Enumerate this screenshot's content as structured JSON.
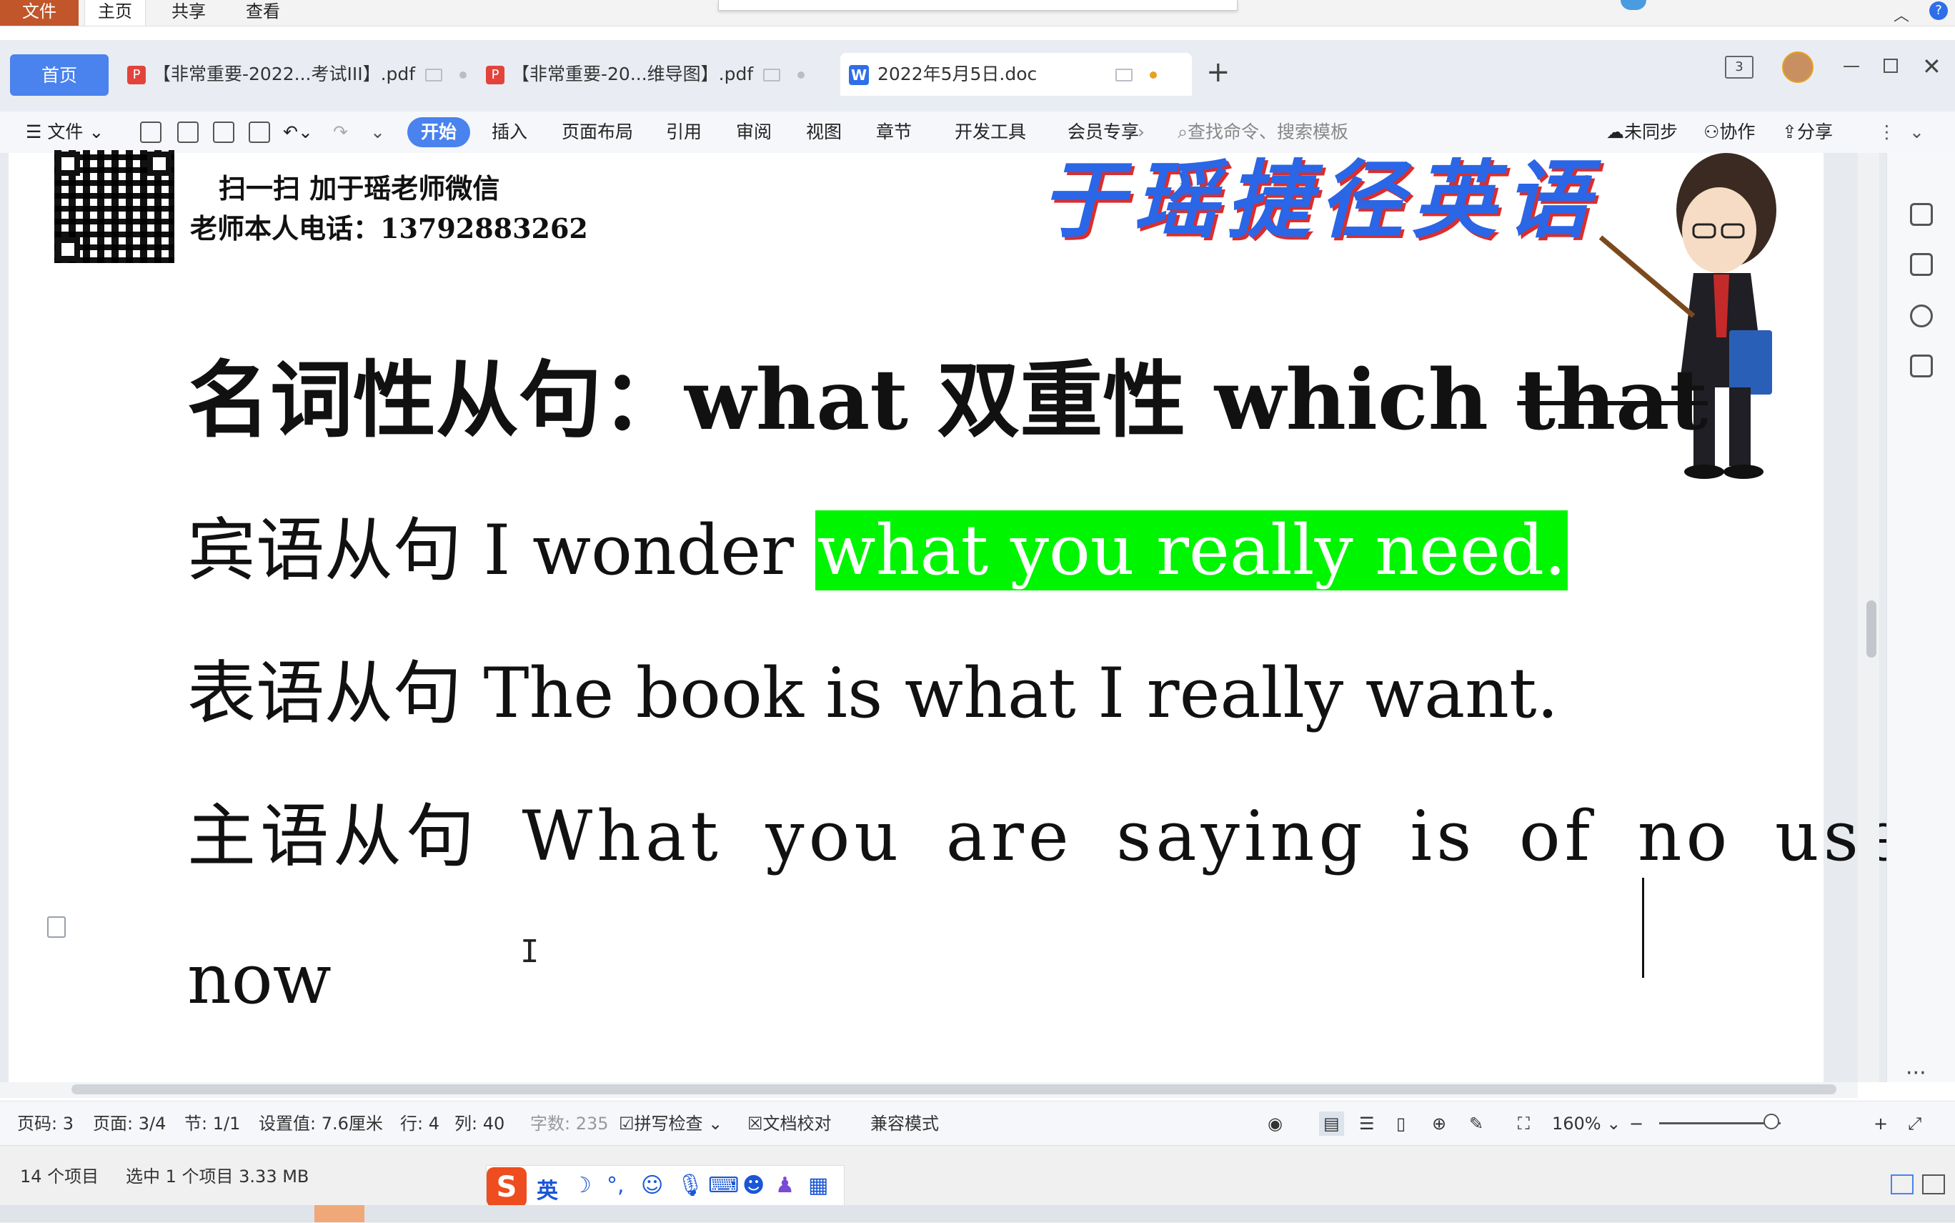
{
  "explorer": {
    "tabs": [
      "文件",
      "主页",
      "共享",
      "查看"
    ],
    "status_items": "14 个项目",
    "status_selected": "选中 1 个项目  3.33 MB"
  },
  "wps": {
    "doc_tabs": [
      {
        "label": "首页"
      },
      {
        "label": "【非常重要-2022...考试III】.pdf"
      },
      {
        "label": "【非常重要-20...维导图】.pdf"
      },
      {
        "label": "2022年5月5日.doc"
      }
    ],
    "new_tab_symbol": "+",
    "account_badge": "3",
    "toolbar": {
      "file_menu": "文件",
      "ribbon_tabs": [
        "开始",
        "插入",
        "页面布局",
        "引用",
        "审阅",
        "视图",
        "章节",
        "开发工具",
        "会员专享"
      ],
      "search_placeholder": "查找命令、搜索模板",
      "sync": "未同步",
      "collab": "协作",
      "share": "分享"
    },
    "status": {
      "page_code": "页码: 3",
      "page": "页面: 3/4",
      "section": "节: 1/1",
      "setting": "设置值: 7.6厘米",
      "row": "行: 4",
      "col": "列: 40",
      "words": "字数: 235",
      "spell": "拼写检查",
      "proof": "文档校对",
      "compat": "兼容模式",
      "zoom": "160%"
    }
  },
  "document": {
    "header_line1": "扫一扫   加于瑶老师微信",
    "header_line2": "老师本人电话：13792883262",
    "logo": "于瑶捷径英语",
    "title_main": "名词性从句：what 双重性  which ",
    "title_strike": "that",
    "object_label": "宾语从句 I wonder ",
    "object_highlight": "what you really need.",
    "predicative": "表语从句  The book is what I really want.",
    "subject": "主语从句  What you are saying is of no use",
    "subject_cont": "now"
  },
  "ime": {
    "label": "英"
  },
  "colors": {
    "accent": "#4a82ee",
    "highlight": "#00f500",
    "explorer_file": "#c0562a"
  }
}
